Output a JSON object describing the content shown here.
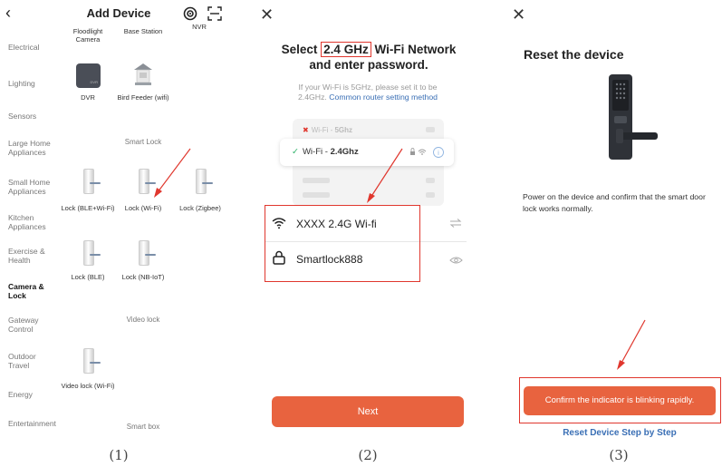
{
  "panel1": {
    "title": "Add Device",
    "back_icon": "back-chevron-icon",
    "top_icons": [
      "scan-radar-icon",
      "qr-scan-icon"
    ],
    "top_partial_labels": [
      "Floodlight Camera",
      "Base Station",
      "NVR"
    ],
    "categories": [
      "Electrical",
      "Lighting",
      "Sensors",
      "Large Home Appliances",
      "Small Home Appliances",
      "Kitchen Appliances",
      "Exercise & Health",
      "Camera & Lock",
      "Gateway Control",
      "Outdoor Travel",
      "Energy",
      "Entertainment"
    ],
    "active_category": "Camera & Lock",
    "devices": {
      "dvr": "DVR",
      "bird_feeder": "Bird Feeder (wifi)",
      "lock_ble_wifi": "Lock (BLE+Wi-Fi)",
      "lock_wifi": "Lock (Wi-Fi)",
      "lock_zigbee": "Lock (Zigbee)",
      "lock_ble": "Lock (BLE)",
      "lock_nbiot": "Lock (NB-IoT)",
      "video_lock_wifi": "Video lock (Wi-Fi)"
    },
    "sections": {
      "smart_lock": "Smart Lock",
      "video_lock": "Video lock",
      "smart_box": "Smart box"
    },
    "label": "(1)"
  },
  "panel2": {
    "close_icon": "close-icon",
    "title_prefix": "Select ",
    "title_highlight": "2.4 GHz",
    "title_suffix": " Wi-Fi Network",
    "title_line2": "and enter password.",
    "subtitle_line1": "If your Wi-Fi is 5GHz, please set it to be",
    "subtitle_line2": "2.4GHz. ",
    "subtitle_link": "Common router setting method",
    "wifi_5g_prefix": "Wi-Fi - ",
    "wifi_5g_band": "5Ghz",
    "wifi_24_prefix": "Wi-Fi - ",
    "wifi_24_band": "2.4Ghz",
    "ssid": "XXXX 2.4G Wi-fi",
    "password": "Smartlock888",
    "next_button": "Next",
    "label": "(2)"
  },
  "panel3": {
    "close_icon": "close-icon",
    "title": "Reset the device",
    "description": "Power on the device and confirm that the smart door lock works normally.",
    "confirm_button": "Confirm the indicator is blinking rapidly.",
    "reset_link": "Reset Device Step by Step",
    "label": "(3)"
  },
  "colors": {
    "accent_button": "#e8633f",
    "highlight_box": "#e0372e",
    "link": "#3a6fb5",
    "ok_check": "#2fb36a"
  }
}
